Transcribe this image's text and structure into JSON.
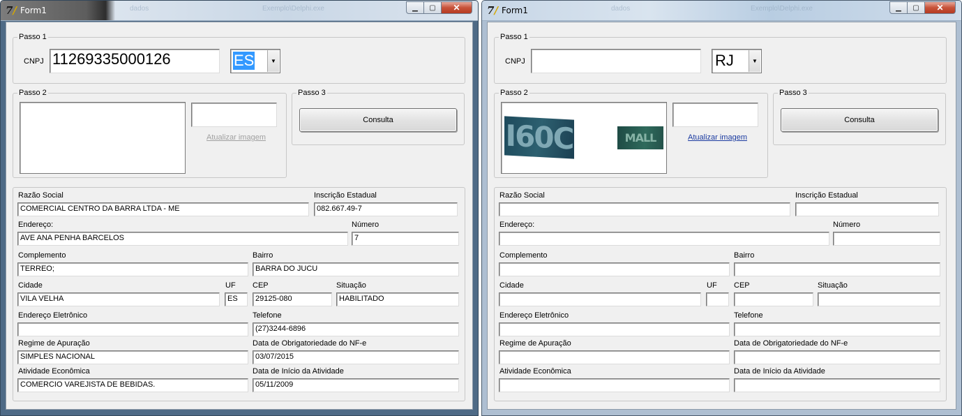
{
  "windows": [
    {
      "title": "Form1",
      "ghost_titles": [
        "dados",
        "Exemplo\\Delphi.exe"
      ],
      "passo1": {
        "legend": "Passo 1",
        "cnpj_label": "CNPJ",
        "cnpj_value": "11269335000126",
        "uf_selected": "ES"
      },
      "passo2": {
        "legend": "Passo 2",
        "captcha_value": "",
        "captcha_text_a": "",
        "captcha_text_b": "",
        "refresh_link": "Atualizar imagem",
        "refresh_enabled": false
      },
      "passo3": {
        "legend": "Passo 3",
        "button": "Consulta"
      },
      "result": {
        "razao_social_label": "Razão Social",
        "razao_social": "COMERCIAL CENTRO DA BARRA LTDA  - ME",
        "ie_label": "Inscrição Estadual",
        "ie": "082.667.49-7",
        "endereco_label": "Endereço:",
        "endereco": "AVE ANA PENHA BARCELOS",
        "numero_label": "Número",
        "numero": "7",
        "complemento_label": "Complemento",
        "complemento": "TERREO;",
        "bairro_label": "Bairro",
        "bairro": "BARRA DO JUCU",
        "cidade_label": "Cidade",
        "cidade": "VILA VELHA",
        "uf_label": "UF",
        "uf": "ES",
        "cep_label": "CEP",
        "cep": "29125-080",
        "situacao_label": "Situação",
        "situacao": "HABILITADO",
        "email_label": "Endereço Eletrônico",
        "email": "",
        "telefone_label": "Telefone",
        "telefone": "(27)3244-6896",
        "regime_label": "Regime de Apuração",
        "regime": "SIMPLES NACIONAL",
        "obrig_label": "Data de Obrigatoriedade do NF-e",
        "obrig": "03/07/2015",
        "atividade_label": "Atividade Econômica",
        "atividade": "COMERCIO VAREJISTA DE BEBIDAS.",
        "inicio_label": "Data de Início da Atividade",
        "inicio": "05/11/2009"
      }
    },
    {
      "title": "Form1",
      "ghost_titles": [
        "dados",
        "Exemplo\\Delphi.exe"
      ],
      "passo1": {
        "legend": "Passo 1",
        "cnpj_label": "CNPJ",
        "cnpj_value": "",
        "uf_selected": "RJ"
      },
      "passo2": {
        "legend": "Passo 2",
        "captcha_value": "",
        "captcha_text_a": "I60C",
        "captcha_text_b": "MALL",
        "refresh_link": "Atualizar imagem",
        "refresh_enabled": true
      },
      "passo3": {
        "legend": "Passo 3",
        "button": "Consulta"
      },
      "result": {
        "razao_social_label": "Razão Social",
        "razao_social": "",
        "ie_label": "Inscrição Estadual",
        "ie": "",
        "endereco_label": "Endereço:",
        "endereco": "",
        "numero_label": "Número",
        "numero": "",
        "complemento_label": "Complemento",
        "complemento": "",
        "bairro_label": "Bairro",
        "bairro": "",
        "cidade_label": "Cidade",
        "cidade": "",
        "uf_label": "UF",
        "uf": "",
        "cep_label": "CEP",
        "cep": "",
        "situacao_label": "Situação",
        "situacao": "",
        "email_label": "Endereço Eletrônico",
        "email": "",
        "telefone_label": "Telefone",
        "telefone": "",
        "regime_label": "Regime de Apuração",
        "regime": "",
        "obrig_label": "Data de Obrigatoriedade do NF-e",
        "obrig": "",
        "atividade_label": "Atividade Econômica",
        "atividade": "",
        "inicio_label": "Data de Início da Atividade",
        "inicio": ""
      }
    }
  ]
}
